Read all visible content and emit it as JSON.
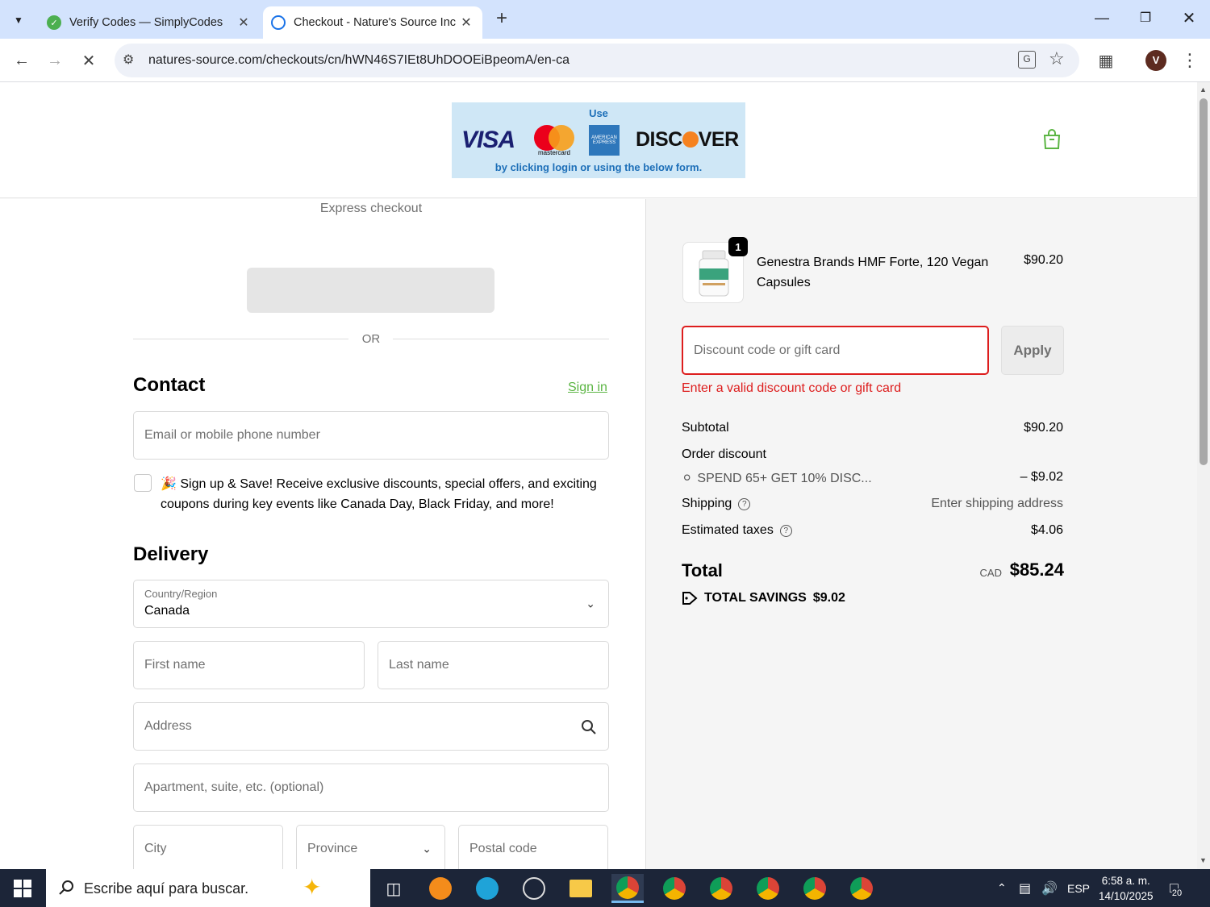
{
  "browser": {
    "tabs": [
      {
        "title": "Verify Codes — SimplyCodes",
        "active": false
      },
      {
        "title": "Checkout - Nature's Source Inc",
        "active": true
      }
    ],
    "url": "natures-source.com/checkouts/cn/hWN46S7IEt8UhDOOEiBpeomA/en-ca",
    "profile_initial": "V"
  },
  "banner": {
    "use": "Use",
    "by": "by clicking login or using the below form.",
    "brands": {
      "visa": "VISA",
      "mastercard": "mastercard",
      "amex": "AMERICAN EXPRESS",
      "discover_pre": "DISC",
      "discover_post": "VER"
    }
  },
  "express": {
    "title": "Express checkout",
    "or": "OR"
  },
  "contact": {
    "heading": "Contact",
    "sign_in": "Sign in",
    "email_placeholder": "Email or mobile phone number",
    "signup_text": "🎉 Sign up & Save! Receive exclusive discounts, special offers, and exciting coupons during key events like Canada Day, Black Friday, and more!"
  },
  "delivery": {
    "heading": "Delivery",
    "country_label": "Country/Region",
    "country_value": "Canada",
    "first_name": "First name",
    "last_name": "Last name",
    "address": "Address",
    "apartment": "Apartment, suite, etc. (optional)",
    "city": "City",
    "province": "Province",
    "postal": "Postal code"
  },
  "summary": {
    "product": {
      "qty": "1",
      "name": "Genestra Brands HMF Forte, 120 Vegan Capsules",
      "price": "$90.20"
    },
    "discount_placeholder": "Discount code or gift card",
    "apply": "Apply",
    "error": "Enter a valid discount code or gift card",
    "subtotal_label": "Subtotal",
    "subtotal": "$90.20",
    "order_discount_label": "Order discount",
    "discount_code": "SPEND 65+ GET 10% DISC...",
    "discount_amount": "– $9.02",
    "shipping_label": "Shipping",
    "shipping_value": "Enter shipping address",
    "taxes_label": "Estimated taxes",
    "taxes": "$4.06",
    "total_label": "Total",
    "currency": "CAD",
    "total": "$85.24",
    "savings_label": "TOTAL SAVINGS",
    "savings": "$9.02"
  },
  "taskbar": {
    "search_placeholder": "Escribe aquí para buscar.",
    "lang": "ESP",
    "time": "6:58 a. m.",
    "date": "14/10/2025",
    "notifications": "20"
  },
  "colors": {
    "accent_green": "#5bb543",
    "error_red": "#dd1d1d",
    "tabbar": "#d3e3fd"
  }
}
